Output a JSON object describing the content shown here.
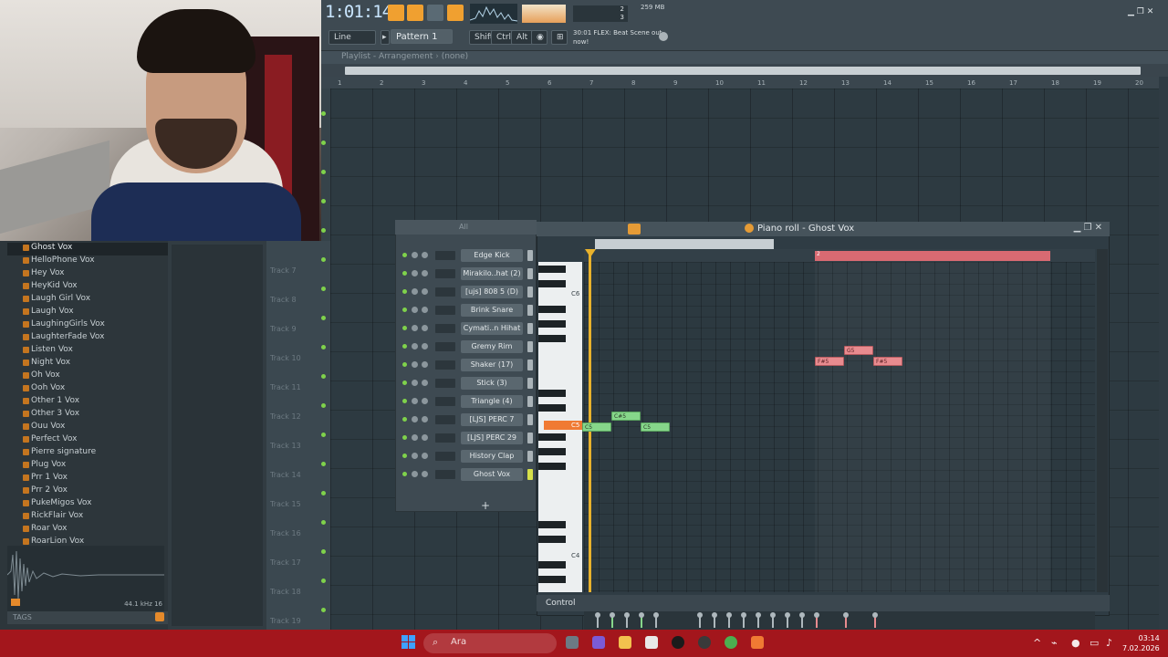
{
  "topbar": {
    "time": "1:01:14",
    "memory": "259 MB",
    "cpu_value": "2",
    "voices": "3",
    "pattern": "Pattern 1",
    "tool": "Line",
    "hint": "30:01  FLEX: Beat Scene out now!",
    "shift_label": "Shift",
    "ctrl_label": "Ctrl",
    "alt_label": "Alt"
  },
  "playlist": {
    "title": "Playlist - Arrangement",
    "arrangement": "(none)",
    "ruler": [
      "1",
      "2",
      "3",
      "4",
      "5",
      "6",
      "7",
      "8",
      "9",
      "10",
      "11",
      "12",
      "13",
      "14",
      "15",
      "16",
      "17",
      "18",
      "19",
      "20"
    ],
    "tracks": [
      "Track 7",
      "Track 8",
      "Track 9",
      "Track 10",
      "Track 11",
      "Track 12",
      "Track 13",
      "Track 14",
      "Track 15",
      "Track 16",
      "Track 17",
      "Track 18",
      "Track 19"
    ]
  },
  "browser": {
    "selected": "Ghost Vox",
    "items": [
      "Ghost Vox",
      "HelloPhone Vox",
      "Hey Vox",
      "HeyKid Vox",
      "Laugh Girl Vox",
      "Laugh Vox",
      "LaughingGirls Vox",
      "LaughterFade Vox",
      "Listen Vox",
      "Night Vox",
      "Oh Vox",
      "Ooh Vox",
      "Other 1 Vox",
      "Other 3 Vox",
      "Ouu Vox",
      "Perfect Vox",
      "Pierre signature",
      "Plug Vox",
      "Prr 1 Vox",
      "Prr 2 Vox",
      "PukeMigos Vox",
      "RickFlair Vox",
      "Roar Vox",
      "RoarLion Vox"
    ],
    "sample_info": "44.1 kHz 16",
    "tags_label": "TAGS"
  },
  "rack": {
    "filter": "All",
    "channels": [
      "Edge Kick",
      "Mirakilo..hat (2)",
      "[ujs] 808 5 (D)",
      "Brink Snare",
      "Cymati..n Hihat",
      "Gremy Rim",
      "Shaker (17)",
      "Stick (3)",
      "Triangle (4)",
      "[LJS] PERC 7",
      "[LJS] PERC 29",
      "History Clap",
      "Ghost Vox"
    ],
    "add_label": "+"
  },
  "pianoroll": {
    "title": "Piano roll - Ghost Vox",
    "key_labels": [
      "C6",
      "C5",
      "C4"
    ],
    "notes": [
      {
        "label": "C#5",
        "color": "green"
      },
      {
        "label": "C5",
        "color": "green"
      },
      {
        "label": "C5",
        "color": "green"
      },
      {
        "label": "G5",
        "color": "red"
      },
      {
        "label": "F#5",
        "color": "red"
      },
      {
        "label": "F#5",
        "color": "red"
      }
    ],
    "control_label": "Control",
    "loop_marker": "2"
  },
  "taskbar": {
    "search_placeholder": "Ara",
    "time": "03:14",
    "date": "7.02.2026"
  },
  "colors": {
    "accent_orange": "#f0a030",
    "note_green": "#86d68a",
    "note_red": "#e88b8f",
    "taskbar_red": "#a3161c"
  }
}
